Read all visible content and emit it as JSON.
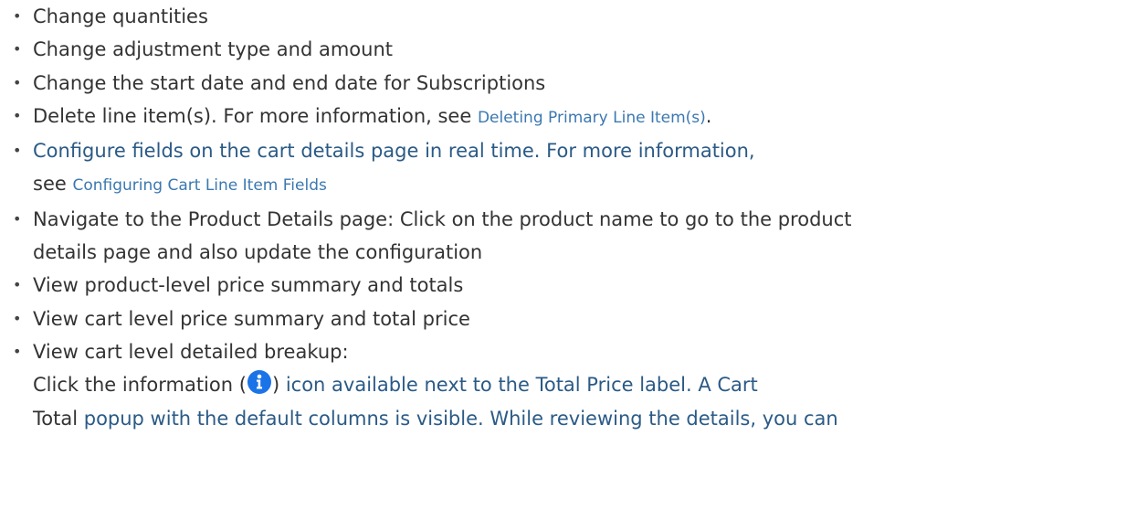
{
  "items": [
    {
      "text": "Change quantities"
    },
    {
      "text": "Change adjustment type and amount"
    },
    {
      "text": "Change the start date and end date for Subscriptions"
    },
    {
      "pre": "Delete line item(s). For more information, see ",
      "link": "Deleting Primary Line Item(s)",
      "post": "."
    },
    {
      "line1": "Configure fields on the cart details page in real time. For more information,",
      "see": "see ",
      "link": "Configuring Cart Line Item Fields"
    },
    {
      "line1": "Navigate to the Product Details page: Click on the product name to go to the product",
      "line2": "details page and also update the configuration"
    },
    {
      "text": "View product-level price summary and totals"
    },
    {
      "text": "View cart level price summary and total price"
    },
    {
      "text": "View cart level detailed breakup:"
    }
  ],
  "paragraph": {
    "part1": "Click the information (",
    "icon": "info-icon",
    "part2": ")",
    "part3": " icon available next to the Total Price label. A Cart",
    "line2a": "Total ",
    "line2b": "popup with the default columns is visible. While reviewing the details, you can"
  },
  "colors": {
    "text": "#333333",
    "blue_text": "#2a5a86",
    "link": "#3b78b0",
    "info_icon": "#1b73e8"
  }
}
